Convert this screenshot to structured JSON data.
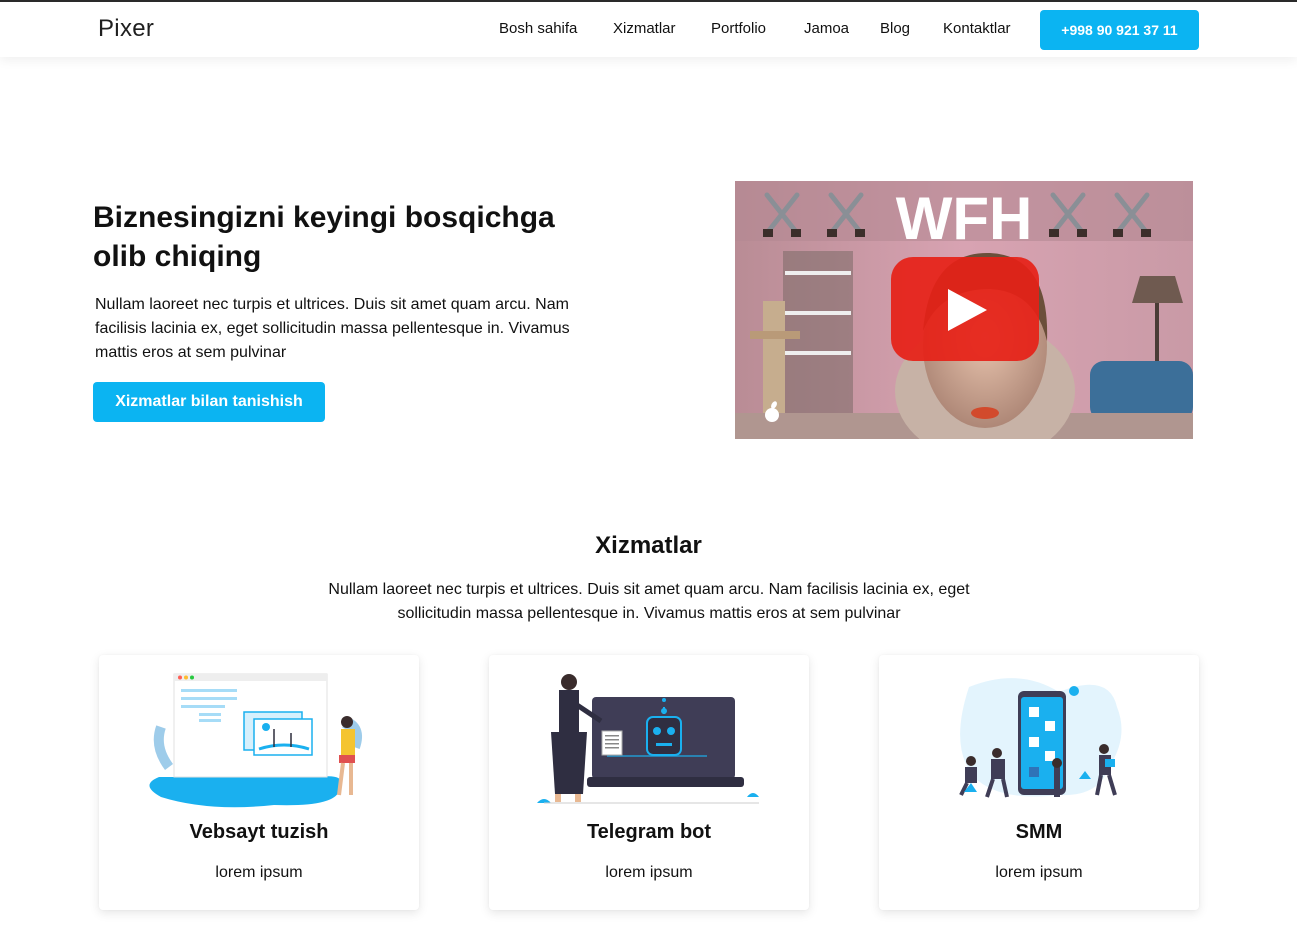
{
  "brand": {
    "logo": "Pixer",
    "accent": "#0bb4f2"
  },
  "nav": {
    "items": [
      "Bosh sahifa",
      "Xizmatlar",
      "Portfolio",
      "Jamoa",
      "Blog",
      "Kontaktlar"
    ],
    "phone": "+998 90 921 37 11"
  },
  "hero": {
    "title": "Biznesingizni keyingi bosqichga olib chiqing",
    "text": "Nullam laoreet nec turpis et ultrices. Duis sit amet quam arcu. Nam facilisis lacinia ex, eget sollicitudin massa pellentesque in. Vivamus mattis eros at sem pulvinar",
    "button": "Xizmatlar bilan tanishish",
    "video": {
      "overlay_text": "WFH",
      "play_icon": "youtube-play-icon"
    }
  },
  "services": {
    "title": "Xizmatlar",
    "text": "Nullam laoreet nec turpis et ultrices. Duis sit amet quam arcu. Nam facilisis lacinia ex, eget sollicitudin massa pellentesque in. Vivamus mattis eros at sem pulvinar",
    "cards": [
      {
        "title": "Vebsayt tuzish",
        "desc": "lorem ipsum",
        "icon": "website-illustration"
      },
      {
        "title": "Telegram bot",
        "desc": "lorem ipsum",
        "icon": "bot-illustration"
      },
      {
        "title": "SMM",
        "desc": "lorem ipsum",
        "icon": "smm-illustration"
      }
    ]
  }
}
